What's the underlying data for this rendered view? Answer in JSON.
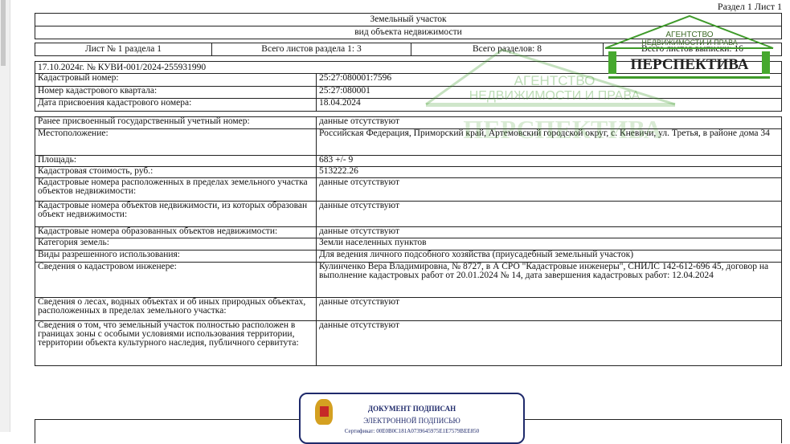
{
  "page_header": "Раздел 1 Лист 1",
  "title": "Земельный участок",
  "subtitle": "вид объекта недвижимости",
  "sheet_info": [
    "Лист № 1 раздела 1",
    "Всего листов раздела 1: 3",
    "Всего разделов: 8",
    "Всего листов выписки: 16"
  ],
  "doc_number": "17.10.2024г. № КУВИ-001/2024-255931990",
  "block1": [
    {
      "label": "Кадастровый номер:",
      "value": "25:27:080001:7596"
    },
    {
      "label": "Номер кадастрового квартала:",
      "value": "25:27:080001"
    },
    {
      "label": "Дата присвоения кадастрового номера:",
      "value": "18.04.2024"
    }
  ],
  "block2": [
    {
      "label": "Ранее присвоенный государственный учетный номер:",
      "value": "данные отсутствуют"
    },
    {
      "label": "Местоположение:",
      "value": "Российская Федерация, Приморский край, Артемовский городской округ, с. Кневичи, ул. Третья, в районе дома 34"
    },
    {
      "label": "Площадь:",
      "value": "683 +/- 9"
    },
    {
      "label": "Кадастровая стоимость, руб.:",
      "value": "513222.26"
    },
    {
      "label": "Кадастровые номера расположенных в пределах земельного участка объектов недвижимости:",
      "value": "данные отсутствуют"
    },
    {
      "label": "Кадастровые номера объектов недвижимости, из которых образован объект недвижимости:",
      "value": "данные отсутствуют"
    },
    {
      "label": "Кадастровые номера образованных объектов недвижимости:",
      "value": "данные отсутствуют"
    },
    {
      "label": "Категория земель:",
      "value": "Земли населенных пунктов"
    },
    {
      "label": "Виды разрешенного использования:",
      "value": "Для ведения личного подсобного хозяйства (приусадебный земельный участок)"
    },
    {
      "label": "Сведения о кадастровом инженере:",
      "value": "Кулинченко Вера Владимировна, № 8727, в А СРО \"Кадастровые инженеры\", СНИЛС 142-612-696 45, договор на выполнение кадастровых работ от 20.01.2024 № 14, дата завершения кадастровых работ: 12.04.2024"
    },
    {
      "label": "Сведения о лесах, водных объектах и об иных природных объектах, расположенных в пределах земельного участка:",
      "value": "данные отсутствуют"
    },
    {
      "label": "Сведения о том, что земельный участок полностью расположен в границах зоны с особыми условиями использования территории, территории объекта культурного наследия, публичного сервитута:",
      "value": "данные отсутствуют"
    }
  ],
  "watermark": {
    "line1": "АГЕНТСТВО",
    "line2": "НЕДВИЖИМОСТИ И ПРАВА",
    "brand": "ПЕРСПЕКТИВА",
    "color": "#3f9a2a"
  },
  "signature": {
    "line1": "ДОКУМЕНТ ПОДПИСАН",
    "line2": "ЭЛЕКТРОННОЙ ПОДПИСЬЮ",
    "cert": "Сертификат: 00E0B0C181A0739645975E1E7579BEE850"
  }
}
